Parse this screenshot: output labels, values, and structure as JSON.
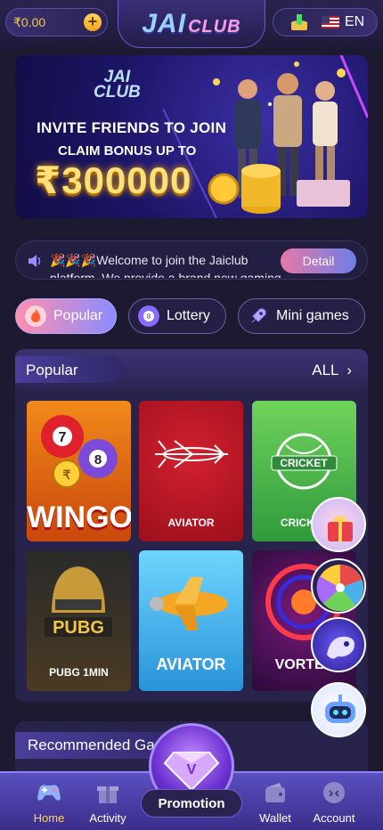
{
  "header": {
    "balance": "₹0.00",
    "add_symbol": "+",
    "logo_primary": "JAI",
    "logo_secondary": "CLUB",
    "language": "EN"
  },
  "banner": {
    "logo_primary": "JAI",
    "logo_secondary": "CLUB",
    "headline": "INVITE FRIENDS TO JOIN",
    "subline": "CLAIM BONUS UP TO",
    "amount": "₹300000"
  },
  "notice": {
    "text": "🎉🎉🎉Welcome to join the Jaiclub platform. We provide a brand new gaming exp...",
    "detail_label": "Detail"
  },
  "categories": [
    {
      "label": "Popular",
      "active": true
    },
    {
      "label": "Lottery",
      "active": false
    },
    {
      "label": "Mini games",
      "active": false
    }
  ],
  "popular": {
    "title": "Popular",
    "all_label": "ALL",
    "games": [
      {
        "label": "WINGO",
        "color": "#ea6a12"
      },
      {
        "label": "AVIATOR",
        "color": "#c01827"
      },
      {
        "label": "CRICKET",
        "color": "#43b24a"
      },
      {
        "label": "PUBG 1MIN",
        "color": "#3a3225"
      },
      {
        "label": "AVIATOR",
        "color": "#3bb6ec"
      },
      {
        "label": "VORTEX",
        "color": "#3a1250"
      }
    ]
  },
  "recommended": {
    "title": "Recommended Games"
  },
  "nav": {
    "items": [
      {
        "label": "Home",
        "icon": "gamepad-icon",
        "active": true
      },
      {
        "label": "Activity",
        "icon": "gift-icon",
        "active": false
      },
      {
        "label": "Promotion",
        "icon": "diamond-icon",
        "active": false
      },
      {
        "label": "Wallet",
        "icon": "wallet-icon",
        "active": false
      },
      {
        "label": "Account",
        "icon": "account-icon",
        "active": false
      }
    ]
  },
  "colors": {
    "background": "#1c1931",
    "accent_gold": "#ffd45a",
    "accent_purple": "#5a4fc0"
  }
}
